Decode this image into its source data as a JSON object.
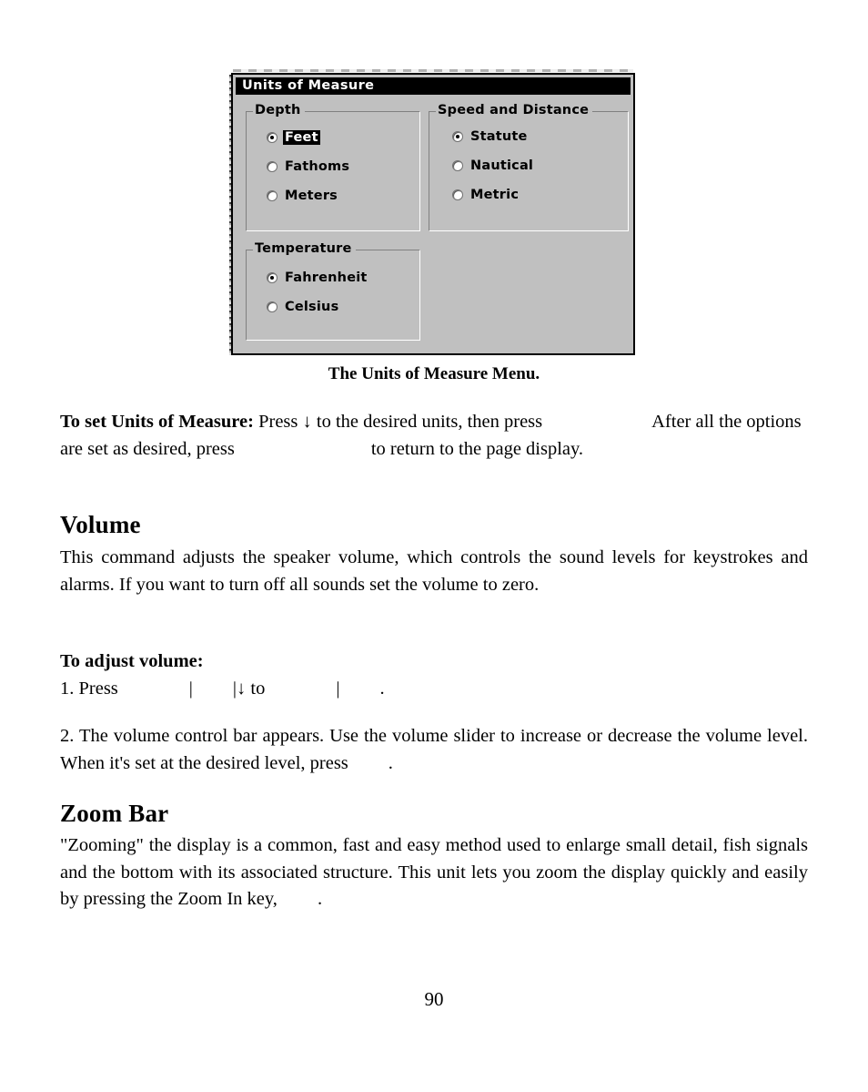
{
  "figure": {
    "dialog": {
      "title": "Units of Measure",
      "groups": [
        {
          "id": "depth",
          "label": "Depth",
          "options": [
            {
              "label": "Feet",
              "checked": true,
              "focused": true
            },
            {
              "label": "Fathoms",
              "checked": false,
              "focused": false
            },
            {
              "label": "Meters",
              "checked": false,
              "focused": false
            }
          ]
        },
        {
          "id": "speed",
          "label": "Speed and Distance",
          "options": [
            {
              "label": "Statute",
              "checked": true,
              "focused": false
            },
            {
              "label": "Nautical",
              "checked": false,
              "focused": false
            },
            {
              "label": "Metric",
              "checked": false,
              "focused": false
            }
          ]
        },
        {
          "id": "temperature",
          "label": "Temperature",
          "options": [
            {
              "label": "Fahrenheit",
              "checked": true,
              "focused": false
            },
            {
              "label": "Celsius",
              "checked": false,
              "focused": false
            }
          ]
        }
      ],
      "colors": {
        "face": "#c0c0c0",
        "titlebar_bg": "#000000",
        "titlebar_fg": "#ffffff",
        "border": "#000000",
        "groupbox_shadow": "#808080",
        "groupbox_highlight": "#ffffff"
      }
    },
    "caption": "The Units of Measure Menu."
  },
  "sections": {
    "units_instructions": {
      "lead_bold": "To set Units of Measure:",
      "line1_a": "Press",
      "arrow": "↓",
      "line1_b": "to the desired units, then press",
      "line2_a": "After all the options are set as desired, press",
      "line2_b": "to return to the",
      "line3": "page display."
    },
    "volume": {
      "heading": "Volume",
      "paragraph": "This command adjusts the speaker volume, which controls the sound levels for keystrokes and alarms. If you want to turn off all sounds set the volume to zero.",
      "subheading": "To adjust volume:",
      "step1_a": "1. Press",
      "step1_pipe1": "|",
      "step1_pipe2": "|",
      "step1_arrow": "↓",
      "step1_b": "to",
      "step1_pipe3": "|",
      "step1_period": ".",
      "step2": "2. The volume control bar appears. Use the volume slider to increase or decrease the volume level. When it's set at the desired level, press",
      "step2_period": "."
    },
    "zoom_bar": {
      "heading": "Zoom Bar",
      "paragraph_a": "\"Zooming\" the display is a common, fast and easy method used to enlarge small detail, fish signals and the bottom with its associated structure. This unit lets you zoom the display quickly and easily by pressing the Zoom In key,",
      "paragraph_period": "."
    }
  },
  "page_number": "90"
}
